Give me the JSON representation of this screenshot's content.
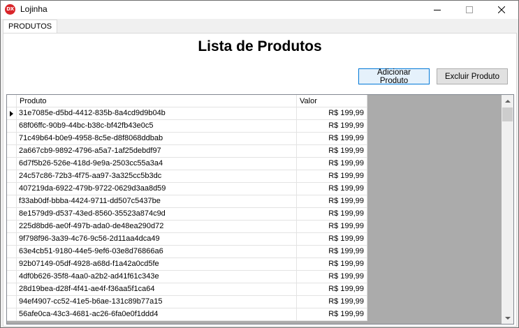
{
  "window": {
    "title": "Lojinha",
    "icon_text": "DX",
    "controls": [
      "minimize-icon",
      "maximize-icon",
      "close-icon"
    ]
  },
  "tabs": [
    {
      "label": "PRODUTOS",
      "active": true
    }
  ],
  "main": {
    "heading": "Lista de Produtos",
    "add_button": "Adicionar Produto",
    "delete_button": "Excluir Produto"
  },
  "grid": {
    "columns": [
      "Produto",
      "Valor"
    ],
    "rows": [
      {
        "produto": "31e7085e-d5bd-4412-835b-8a4cd9d9b04b",
        "valor": "R$ 199,99"
      },
      {
        "produto": "68f06ffc-90b9-44bc-b38c-bf42fb43e0c5",
        "valor": "R$ 199,99"
      },
      {
        "produto": "71c49b64-b0e9-4958-8c5e-d8f8068ddbab",
        "valor": "R$ 199,99"
      },
      {
        "produto": "2a667cb9-9892-4796-a5a7-1af25debdf97",
        "valor": "R$ 199,99"
      },
      {
        "produto": "6d7f5b26-526e-418d-9e9a-2503cc55a3a4",
        "valor": "R$ 199,99"
      },
      {
        "produto": "24c57c86-72b3-4f75-aa97-3a325cc5b3dc",
        "valor": "R$ 199,99"
      },
      {
        "produto": "407219da-6922-479b-9722-0629d3aa8d59",
        "valor": "R$ 199,99"
      },
      {
        "produto": "f33ab0df-bbba-4424-9711-dd507c5437be",
        "valor": "R$ 199,99"
      },
      {
        "produto": "8e1579d9-d537-43ed-8560-35523a874c9d",
        "valor": "R$ 199,99"
      },
      {
        "produto": "225d8bd6-ae0f-497b-ada0-de48ea290d72",
        "valor": "R$ 199,99"
      },
      {
        "produto": "9f798f96-3a39-4c76-9c56-2d11aa4dca49",
        "valor": "R$ 199,99"
      },
      {
        "produto": "63e4cb51-9180-44e5-9ef6-03e8d76866a6",
        "valor": "R$ 199,99"
      },
      {
        "produto": "92b07149-05df-4928-a68d-f1a42a0cd5fe",
        "valor": "R$ 199,99"
      },
      {
        "produto": "4df0b626-35f8-4aa0-a2b2-ad41f61c343e",
        "valor": "R$ 199,99"
      },
      {
        "produto": "28d19bea-d28f-4f41-ae4f-f36aa5f1ca64",
        "valor": "R$ 199,99"
      },
      {
        "produto": "94ef4907-cc52-41e5-b6ae-131c89b77a15",
        "valor": "R$ 199,99"
      },
      {
        "produto": "56afe0ca-43c3-4681-ac26-6fa0e0f1ddd4",
        "valor": "R$ 199,99"
      }
    ]
  }
}
